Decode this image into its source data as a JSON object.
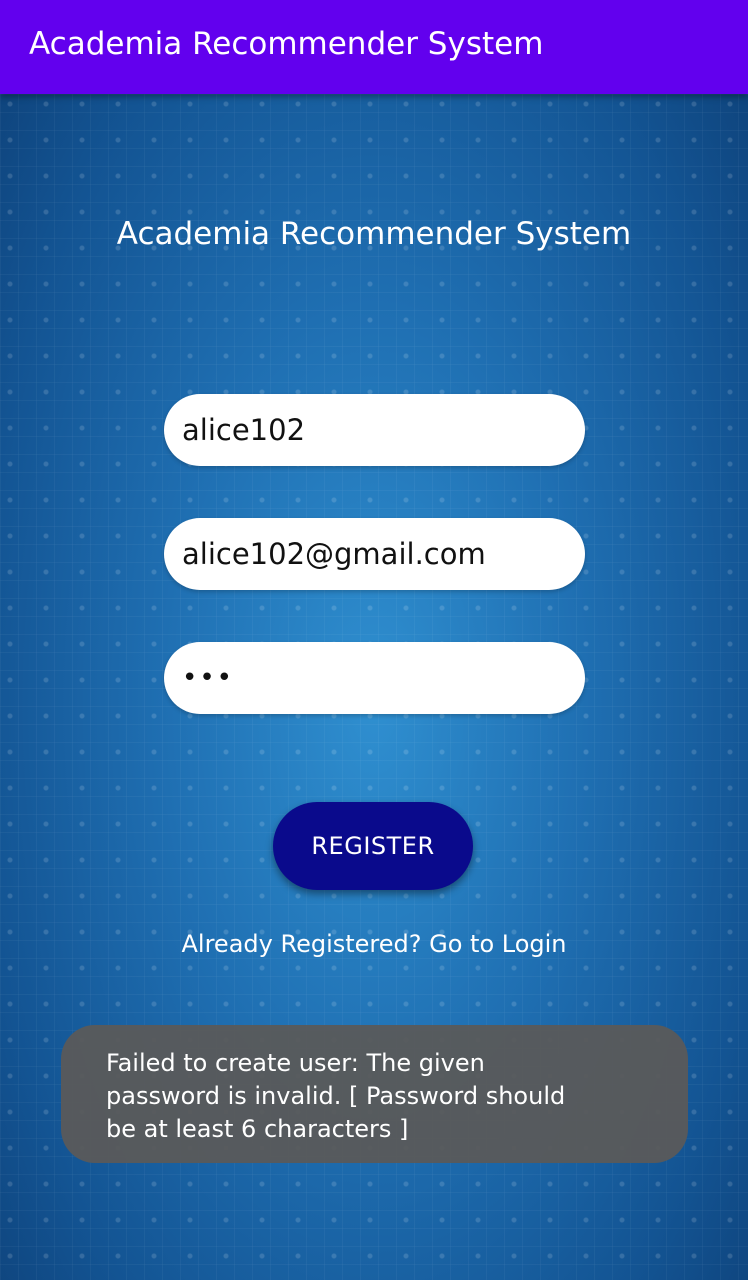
{
  "app_bar": {
    "title": "Academia Recommender System"
  },
  "main": {
    "title": "Academia Recommender System",
    "username_value": "alice102",
    "email_value": "alice102@gmail.com",
    "password_value": "•••",
    "register_label": "REGISTER",
    "login_link": "Already Registered? Go to Login"
  },
  "toast": {
    "message": "Failed to create user: The given password is invalid. [ Password should be at least 6 characters ]"
  },
  "colors": {
    "app_bar": "#6200ee",
    "button": "#0a0a8c",
    "background": "#1f6fb2"
  }
}
